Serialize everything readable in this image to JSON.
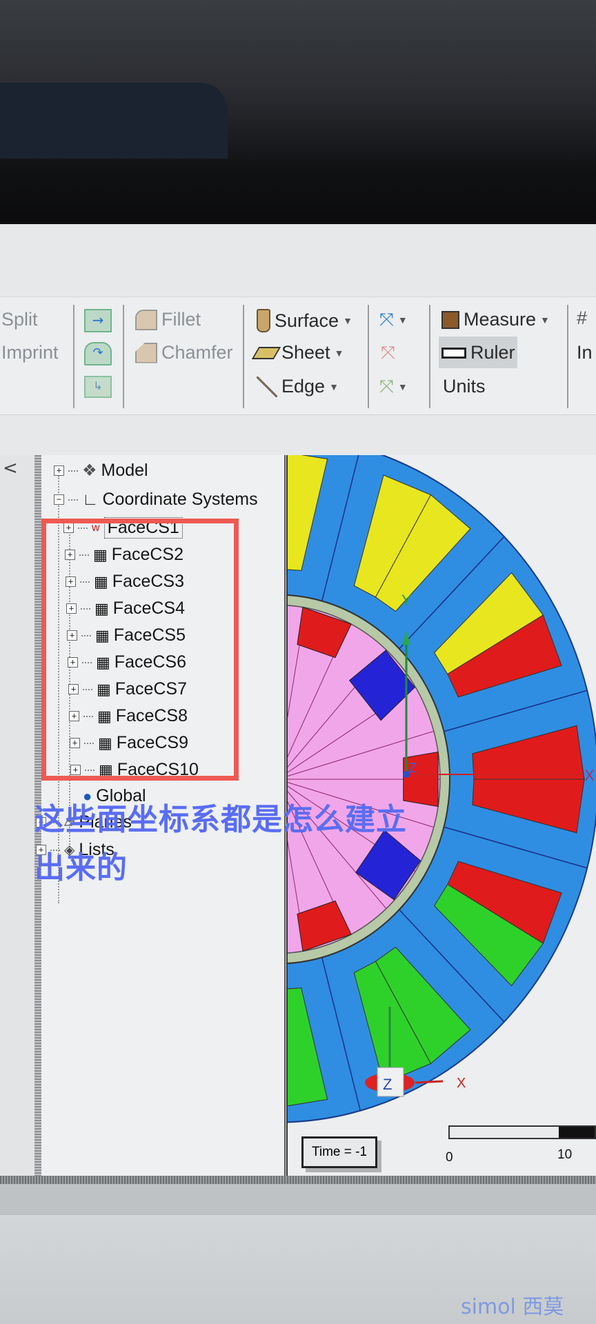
{
  "ribbon": {
    "split": "Split",
    "imprint": "Imprint",
    "fillet": "Fillet",
    "chamfer": "Chamfer",
    "surface": "Surface",
    "sheet": "Sheet",
    "edge": "Edge",
    "measure": "Measure",
    "ruler": "Ruler",
    "units": "Units",
    "in_partial": "In"
  },
  "left_strip": {
    "collapse": "<"
  },
  "tree": {
    "model": "Model",
    "coordinate_systems": "Coordinate Systems",
    "face_cs": [
      "FaceCS1",
      "FaceCS2",
      "FaceCS3",
      "FaceCS4",
      "FaceCS5",
      "FaceCS6",
      "FaceCS7",
      "FaceCS8",
      "FaceCS9",
      "FaceCS10"
    ],
    "global": "Global",
    "planes": "Planes",
    "lists": "Lists"
  },
  "annotation": {
    "line1": "这些面坐标系都是怎么建立",
    "line2": "出来的",
    "box_color": "#ee5a52",
    "text_color": "#5a6df2"
  },
  "viewport": {
    "axis_x": "X",
    "axis_y": "Y",
    "axis_z": "Z",
    "triad_z": "Z",
    "triad_x": "X",
    "time_label": "Time = -1",
    "scale_min": "0",
    "scale_max": "10",
    "colors": {
      "stator": "#2f8ee2",
      "phase_a": "#e01b1b",
      "phase_b": "#e8e61e",
      "phase_c": "#2ed12a",
      "rotor": "#f2a6ea",
      "magnet": "#2424d6"
    }
  },
  "watermark": "simol 西莫"
}
